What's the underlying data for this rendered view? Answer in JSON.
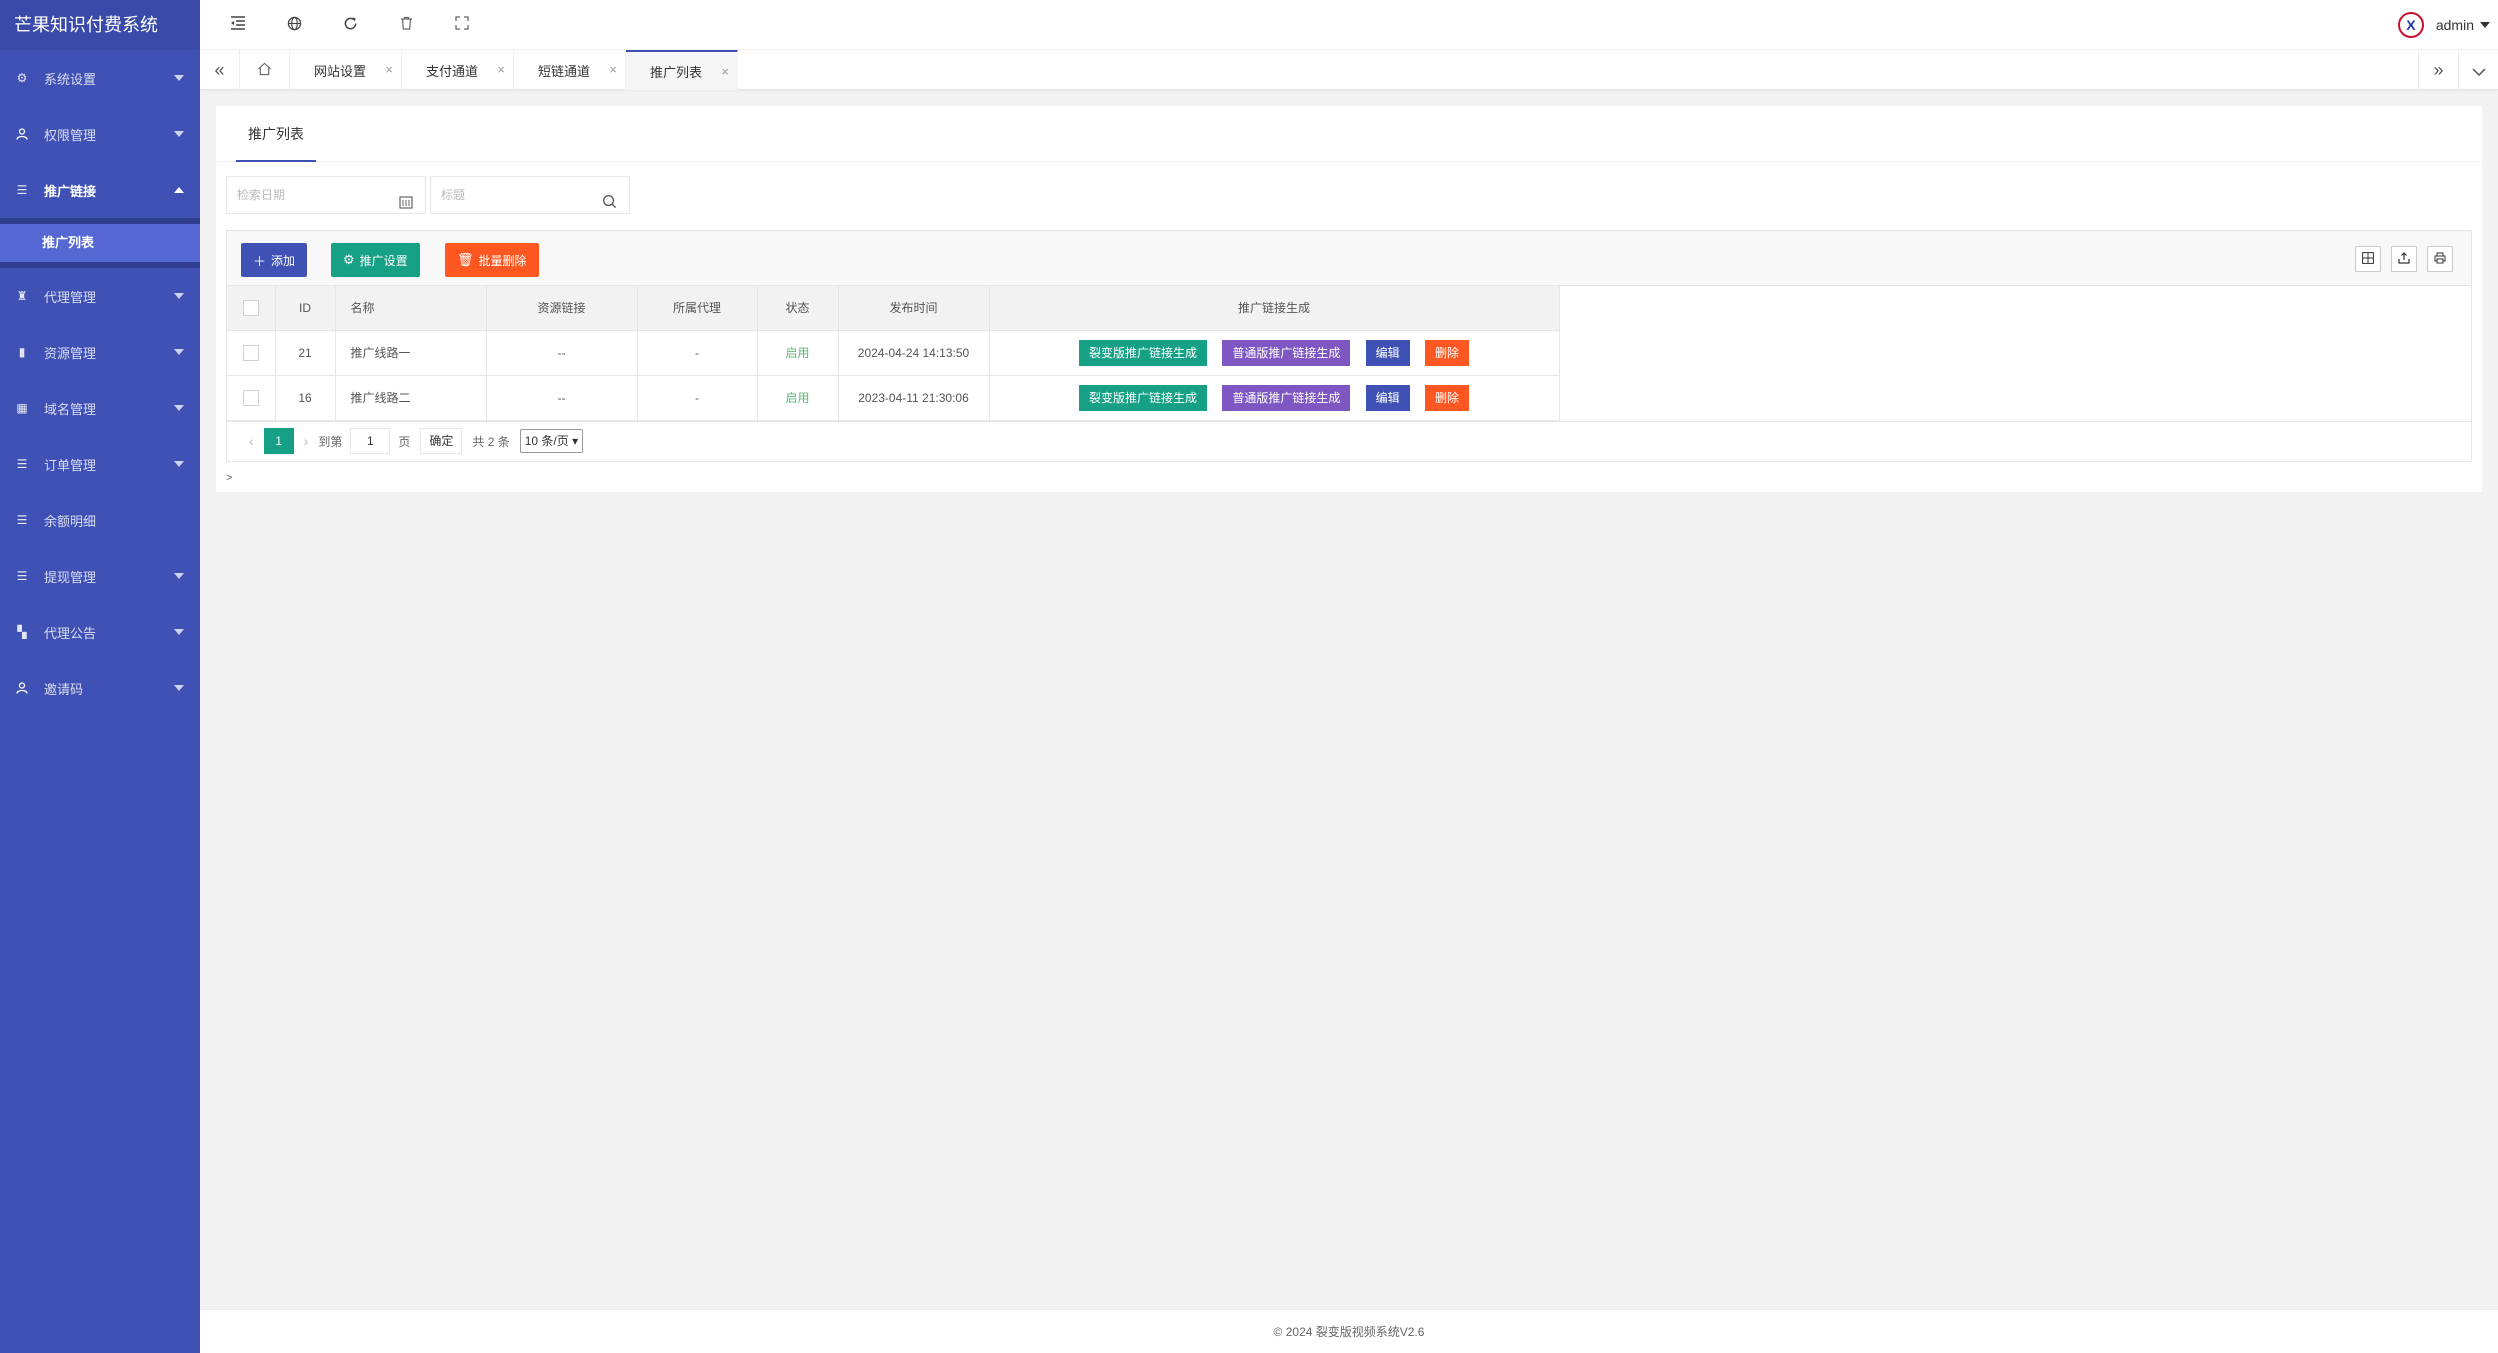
{
  "app": {
    "title": "芒果知识付费系统"
  },
  "sidebar": {
    "items": [
      {
        "label": "系统设置",
        "icon": "gear-icon"
      },
      {
        "label": "权限管理",
        "icon": "user-icon"
      },
      {
        "label": "推广链接",
        "icon": "list-icon",
        "open": true
      },
      {
        "label": "代理管理",
        "icon": "building-icon"
      },
      {
        "label": "资源管理",
        "icon": "bar-chart-icon"
      },
      {
        "label": "域名管理",
        "icon": "calculator-icon"
      },
      {
        "label": "订单管理",
        "icon": "list-icon"
      },
      {
        "label": "余额明细",
        "icon": "list-icon"
      },
      {
        "label": "提现管理",
        "icon": "list-icon"
      },
      {
        "label": "代理公告",
        "icon": "grid-icon"
      },
      {
        "label": "邀请码",
        "icon": "user-icon"
      }
    ],
    "submenu": {
      "label": "推广列表"
    }
  },
  "header": {
    "username": "admin"
  },
  "tabs": [
    {
      "label": "网站设置"
    },
    {
      "label": "支付通道"
    },
    {
      "label": "短链通道"
    },
    {
      "label": "推广列表",
      "active": true
    }
  ],
  "page": {
    "card_tab": "推广列表",
    "search": {
      "date_placeholder": "检索日期",
      "title_placeholder": "标题"
    },
    "toolbar": {
      "add": "添加",
      "settings": "推广设置",
      "batch_delete": "批量删除"
    },
    "table": {
      "headers": [
        "ID",
        "名称",
        "资源链接",
        "所属代理",
        "状态",
        "发布时间",
        "推广链接生成"
      ],
      "rows": [
        {
          "id": "21",
          "name": "推广线路一",
          "resource": "--",
          "agent": "-",
          "status": "启用",
          "time": "2024-04-24 14:13:50"
        },
        {
          "id": "16",
          "name": "推广线路二",
          "resource": "--",
          "agent": "-",
          "status": "启用",
          "time": "2023-04-11 21:30:06"
        }
      ],
      "actions": {
        "fission": "裂变版推广链接生成",
        "normal": "普通版推广链接生成",
        "edit": "编辑",
        "delete": "删除"
      }
    },
    "pager": {
      "current": "1",
      "goto": "到第",
      "page_input": "1",
      "page_unit": "页",
      "ok": "确定",
      "total": "共 2 条",
      "size": "10 条/页"
    },
    "stray": ">"
  },
  "footer": {
    "text": "© 2024 裂变版视频系统V2.6"
  },
  "colors": {
    "sidebar": "#3f51b5",
    "green": "#16a085",
    "purple": "#7e57c2",
    "orange": "#ff5722"
  }
}
